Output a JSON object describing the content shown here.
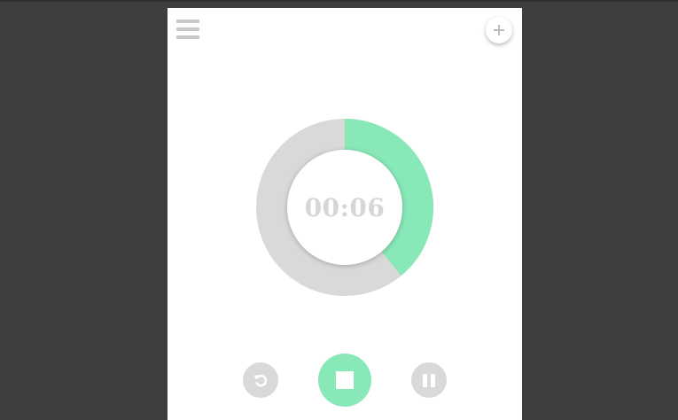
{
  "timer": {
    "display": "00:06",
    "progress_fraction": 0.39
  },
  "colors": {
    "background": "#3e3e3e",
    "card": "#ffffff",
    "accent": "#88e8b8",
    "track": "#d9d9d9",
    "muted_text": "#d6d6d6"
  },
  "icons": {
    "menu": "hamburger-menu-icon",
    "add": "plus-icon",
    "reset": "reset-icon",
    "stop": "stop-icon",
    "pause": "pause-icon"
  },
  "add_button": {
    "label": "+"
  }
}
